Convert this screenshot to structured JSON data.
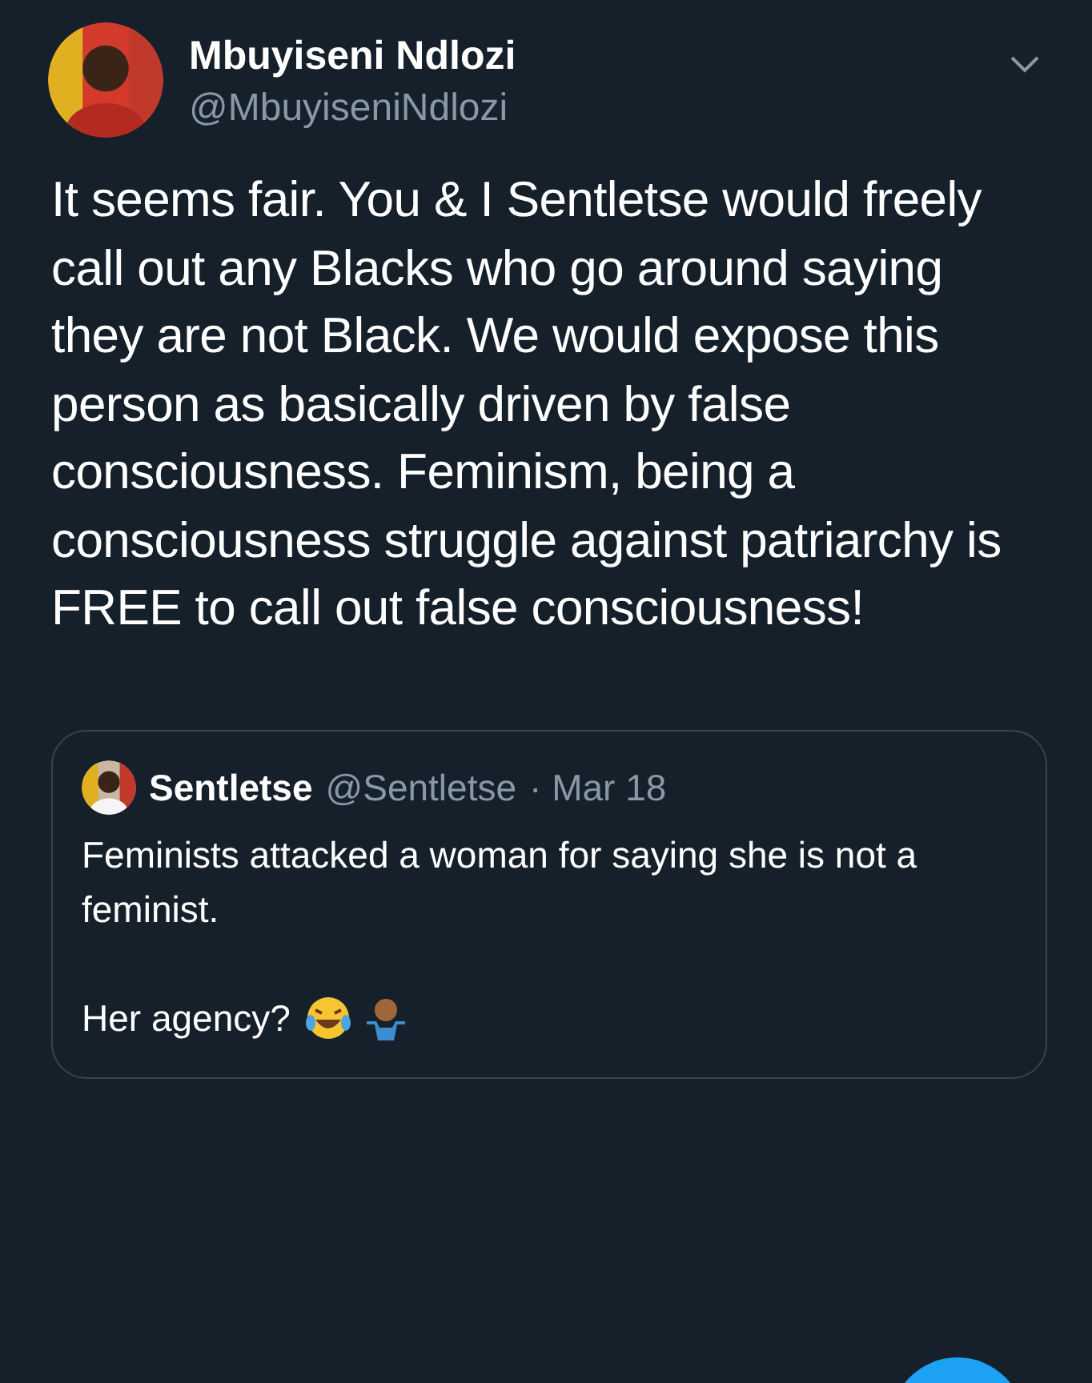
{
  "author": {
    "name": "Mbuyiseni Ndlozi",
    "handle": "@MbuyiseniNdlozi"
  },
  "body": "It seems fair. You & I Sentletse would freely call out any Blacks who go around saying they are not Black. We would expose this person as basically driven by false consciousness. Feminism, being a consciousness struggle against patriarchy is FREE to call out false consciousness!",
  "quoted": {
    "name": "Sentletse",
    "handle": "@Sentletse",
    "date": "· Mar 18",
    "paragraphs": [
      "Feminists attacked a woman for saying she is not a feminist.",
      "Her agency?"
    ]
  }
}
